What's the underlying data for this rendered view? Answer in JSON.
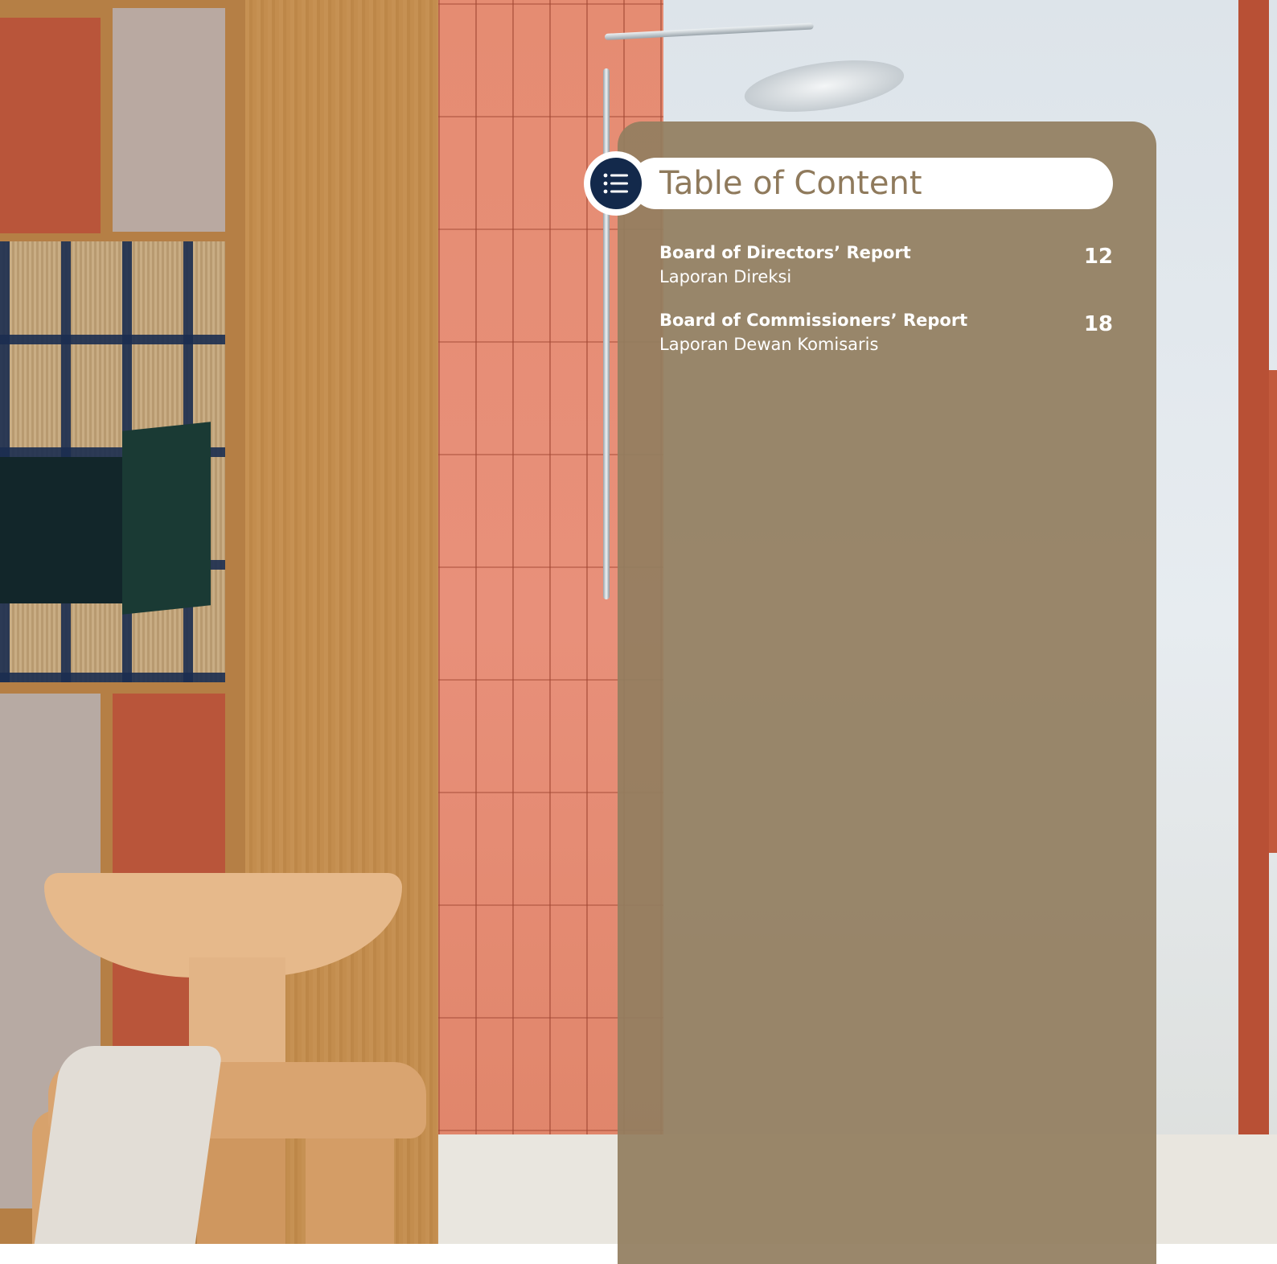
{
  "toc": {
    "title": "Table of Content",
    "icon": "list-icon",
    "entries": [
      {
        "title": "Board of Directors’ Report",
        "subtitle": "Laporan Direksi",
        "page": "12"
      },
      {
        "title": "Board of Commissioners’ Report",
        "subtitle": "Laporan Dewan Komisaris",
        "page": "18"
      }
    ]
  },
  "colors": {
    "card_background": "#927e60",
    "header_pill": "#ffffff",
    "title_text": "#8f7a5c",
    "icon_circle": "#13294b",
    "entry_text": "#ffffff"
  }
}
